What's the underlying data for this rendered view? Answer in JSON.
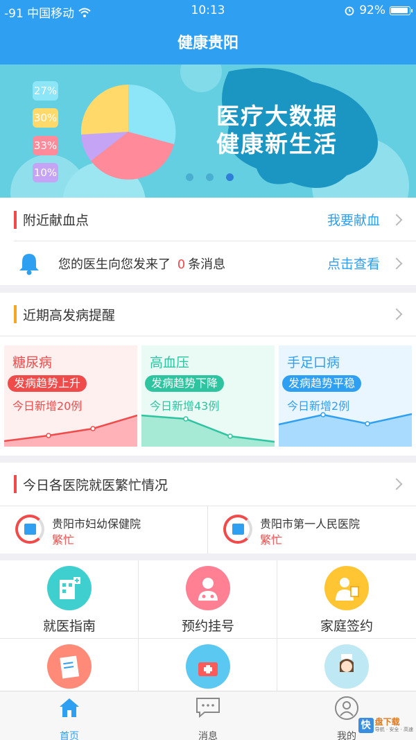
{
  "status_bar": {
    "carrier": "-91 中国移动",
    "time": "10:13",
    "battery": "92%"
  },
  "nav": {
    "title": "健康贵阳"
  },
  "banner": {
    "percentages": [
      "27%",
      "30%",
      "33%",
      "10%"
    ],
    "headline_line1": "医疗大数据",
    "headline_line2": "健康新生活",
    "page_count": 3,
    "active_page": 3
  },
  "blood": {
    "title": "附近献血点",
    "link": "我要献血"
  },
  "message": {
    "prefix": "您的医生向您发来了",
    "count": "0",
    "suffix": "条消息",
    "link": "点击查看"
  },
  "disease": {
    "title": "近期高发病提醒",
    "cards": [
      {
        "name": "糖尿病",
        "trend": "发病趋势上升",
        "today": "今日新增20例"
      },
      {
        "name": "高血压",
        "trend": "发病趋势下降",
        "today": "今日新增43例"
      },
      {
        "name": "手足口病",
        "trend": "发病趋势平稳",
        "today": "今日新增2例"
      }
    ]
  },
  "hospitals": {
    "title": "今日各医院就医繁忙情况",
    "items": [
      {
        "name": "贵阳市妇幼保健院",
        "status": "繁忙"
      },
      {
        "name": "贵阳市第一人民医院",
        "status": "繁忙"
      }
    ]
  },
  "services": [
    {
      "label": "就医指南",
      "icon": "hospital-building-icon"
    },
    {
      "label": "预约挂号",
      "icon": "doctor-icon"
    },
    {
      "label": "家庭签约",
      "icon": "family-doctor-icon"
    },
    {
      "label": "",
      "icon": "clipboard-icon"
    },
    {
      "label": "",
      "icon": "medical-kit-icon"
    },
    {
      "label": "",
      "icon": "nurse-icon"
    }
  ],
  "tabs": [
    {
      "label": "首页",
      "icon": "home-icon",
      "active": true
    },
    {
      "label": "消息",
      "icon": "message-icon",
      "active": false
    },
    {
      "label": "我的",
      "icon": "profile-icon",
      "active": false
    }
  ],
  "watermark": {
    "glyph": "快",
    "brand": "盘下载",
    "slogan": "导航 · 安全 · 高速"
  },
  "colors": {
    "primary": "#2f9ff1",
    "alert": "#f04b4b",
    "green": "#2ec4a0",
    "banner": "#64cfe0"
  }
}
